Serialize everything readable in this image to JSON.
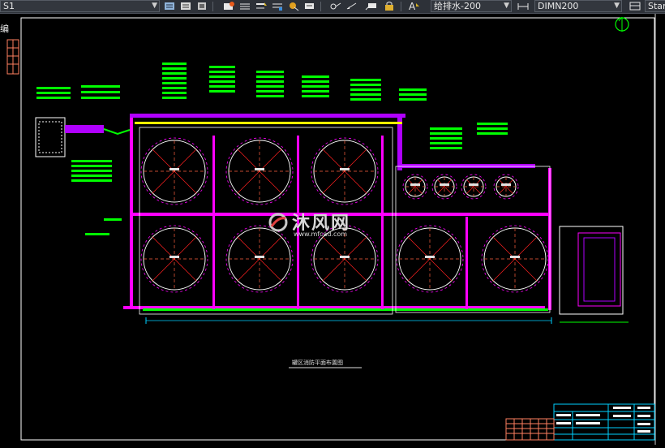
{
  "toolbar": {
    "layer_value": "S1",
    "pipe_style_value": "给排水-200",
    "dim_style_value": "DIMN200",
    "start_value": "Star"
  },
  "drawing": {
    "plan_title": "罐区消防平面布置图",
    "left_margin_label": "编"
  },
  "watermark": {
    "brand": "沐风网",
    "url": "www.mfcad.com"
  },
  "colors": {
    "background": "#000000",
    "frame": "#ffffff",
    "pipe_main": "#b000ff",
    "pipe_branch": "#ff00ff",
    "tank_outline": "#ffffff",
    "cross_lines": "#ff2020",
    "green": "#00ff00",
    "yellow": "#ffff00",
    "cyan": "#00d0ff",
    "salmon_grid": "#ff8060"
  },
  "icons": [
    "paragraph-icon",
    "text-style-icon",
    "layer-icon",
    "properties-icon",
    "linetype-icon",
    "lineweight-icon",
    "color-icon",
    "match-icon",
    "block-icon",
    "dimension-icon",
    "text-icon",
    "dim-style-icon",
    "north-arrow-icon"
  ]
}
